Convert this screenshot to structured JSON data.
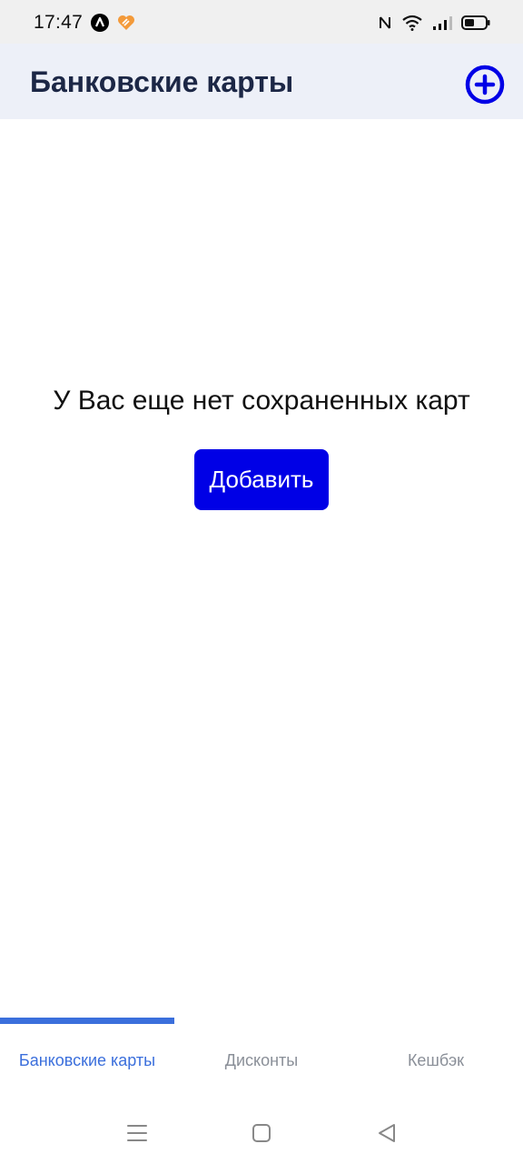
{
  "status_bar": {
    "time": "17:47"
  },
  "header": {
    "title": "Банковские карты"
  },
  "empty_state": {
    "message": "У Вас еще нет сохраненных карт",
    "button_label": "Добавить"
  },
  "tabs": [
    {
      "label": "Банковские карты",
      "active": true
    },
    {
      "label": "Дисконты",
      "active": false
    },
    {
      "label": "Кешбэк",
      "active": false
    }
  ],
  "colors": {
    "accent": "#0000e6",
    "tab_active": "#3b6fdc",
    "header_bg": "#edf0f8",
    "title": "#1c2746"
  },
  "icons": {
    "header_action": "plus-circle-icon",
    "nav": [
      "menu-icon",
      "home-icon",
      "back-icon"
    ]
  }
}
